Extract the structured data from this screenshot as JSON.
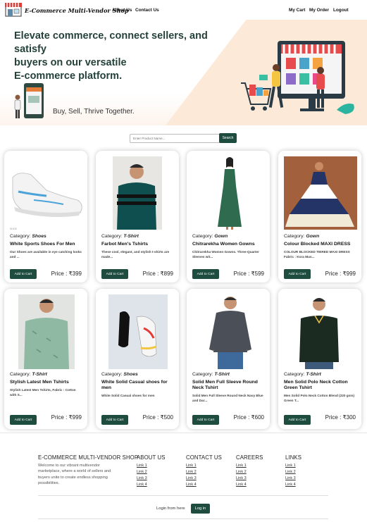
{
  "nav": {
    "brand": "E-Commerce Multi-Vendor Shop",
    "about": "About Us",
    "contact": "Contact Us",
    "cart": "My Cart",
    "orders": "My Order",
    "logout": "Logout"
  },
  "hero": {
    "headline_1": "Elevate commerce, connect sellers, and satisfy",
    "headline_2": "buyers on our versatile",
    "headline_3": "E-commerce platform.",
    "tagline": "Buy, Sell, Thrive Together."
  },
  "search": {
    "placeholder": "Enter Product Name...",
    "button": "Search"
  },
  "products": [
    {
      "category_label": "Category:",
      "category": "Shoes",
      "name": "White Sports Shoes For Men",
      "desc": "Our Shoes are available in eye catching looks and ...",
      "add_label": "Add to Cart",
      "price": "Price : ₹399"
    },
    {
      "category_label": "Category:",
      "category": "T-Shirt",
      "name": "Farbot Men's Tshirts",
      "desc": "These cool, elegant, and stylish t-shirts are made...",
      "add_label": "Add to Cart",
      "price": "Price : ₹899"
    },
    {
      "category_label": "Category:",
      "category": "Gown",
      "name": "Chitrarekha Women Gowns",
      "desc": "Chitrarekha Women Gowns. Three-Quarter Sleeves wit...",
      "add_label": "Add to Cart",
      "price": "Price : ₹599"
    },
    {
      "category_label": "Category:",
      "category": "Gown",
      "name": "Colour Blocked MAXI DRESS",
      "desc": "COLOUR BLOCKED TIERED MAXI DRESS Fabric : Kora Mus...",
      "add_label": "Add to Cart",
      "price": "Price : ₹999"
    },
    {
      "category_label": "Category:",
      "category": "T-Shirt",
      "name": "Stylish Latest Men Tshirts",
      "desc": "Stylish Latest Men Tshirts, Fabric : Cotton with S...",
      "add_label": "Add to Cart",
      "price": "Price : ₹999"
    },
    {
      "category_label": "Category:",
      "category": "Shoes",
      "name": "White Solid Casual shoes for men",
      "desc": "White Solid Casual shoes for men",
      "add_label": "Add to Cart",
      "price": "Price : ₹500"
    },
    {
      "category_label": "Category:",
      "category": "T-Shirt",
      "name": "Solid Men Full Sleeve Round Neck Tshirt",
      "desc": "Solid Men Full Sleeve Round Neck Navy Blue and Dar...",
      "add_label": "Add to Cart",
      "price": "Price : ₹600"
    },
    {
      "category_label": "Category:",
      "category": "T-Shirt",
      "name": "Men Solid Polo Neck Cotton Green Tshirt",
      "desc": "Men Solid Polo Neck Cotton Blend (220 gsm) Green T...",
      "add_label": "Add to Cart",
      "price": "Price : ₹300"
    }
  ],
  "footer": {
    "shop_title": "E-COMMERCE MULTI-VENDOR SHOP",
    "shop_desc": "Welcome to our vibrant multivendor marketplace, where a world of sellers and buyers unite to create endless shopping possibilities.",
    "about_title": "ABOUT US",
    "contact_title": "CONTACT US",
    "careers_title": "CAREERS",
    "links_title": "LINKS",
    "links": [
      "Link 1",
      "Link 2",
      "Link 3",
      "Link 4"
    ],
    "login_text": "Login from here",
    "login_button": "Log in"
  },
  "colors": {
    "accent": "#1e4d40",
    "headline": "#24413a",
    "hero_bg": "#fde9d8"
  }
}
